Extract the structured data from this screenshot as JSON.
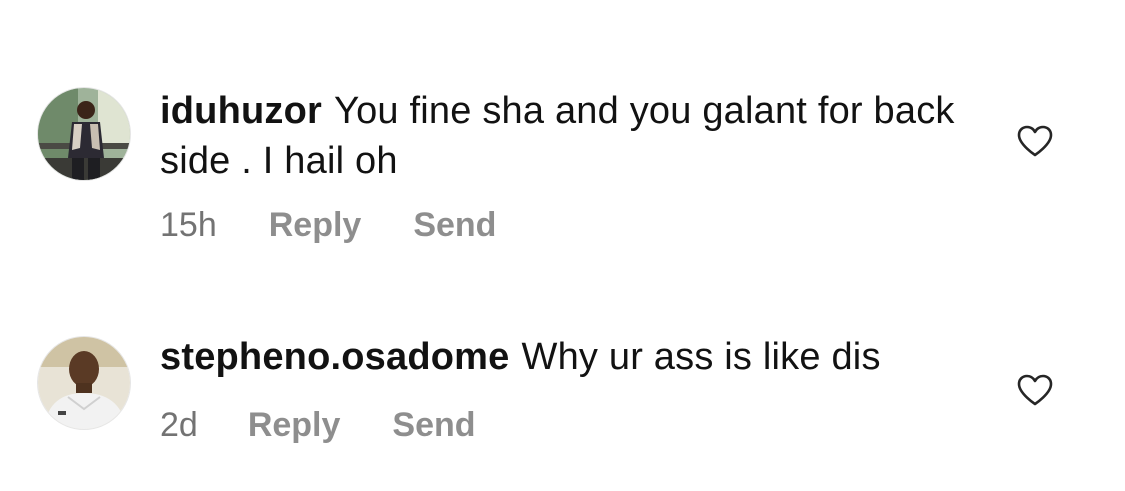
{
  "colors": {
    "text": "#121212",
    "meta_text": "#8e8e8e",
    "timestamp_text": "#737373",
    "heart_outline": "#262626",
    "background": "#ffffff"
  },
  "comments": [
    {
      "username": "iduhuzor",
      "text": "You fine sha and you galant for back side . I hail oh",
      "time": "15h",
      "reply_label": "Reply",
      "send_label": "Send",
      "like_icon": "heart-outline-icon"
    },
    {
      "username": "stepheno.osadome",
      "text": "Why ur ass is like dis",
      "time": "2d",
      "reply_label": "Reply",
      "send_label": "Send",
      "like_icon": "heart-outline-icon"
    }
  ]
}
